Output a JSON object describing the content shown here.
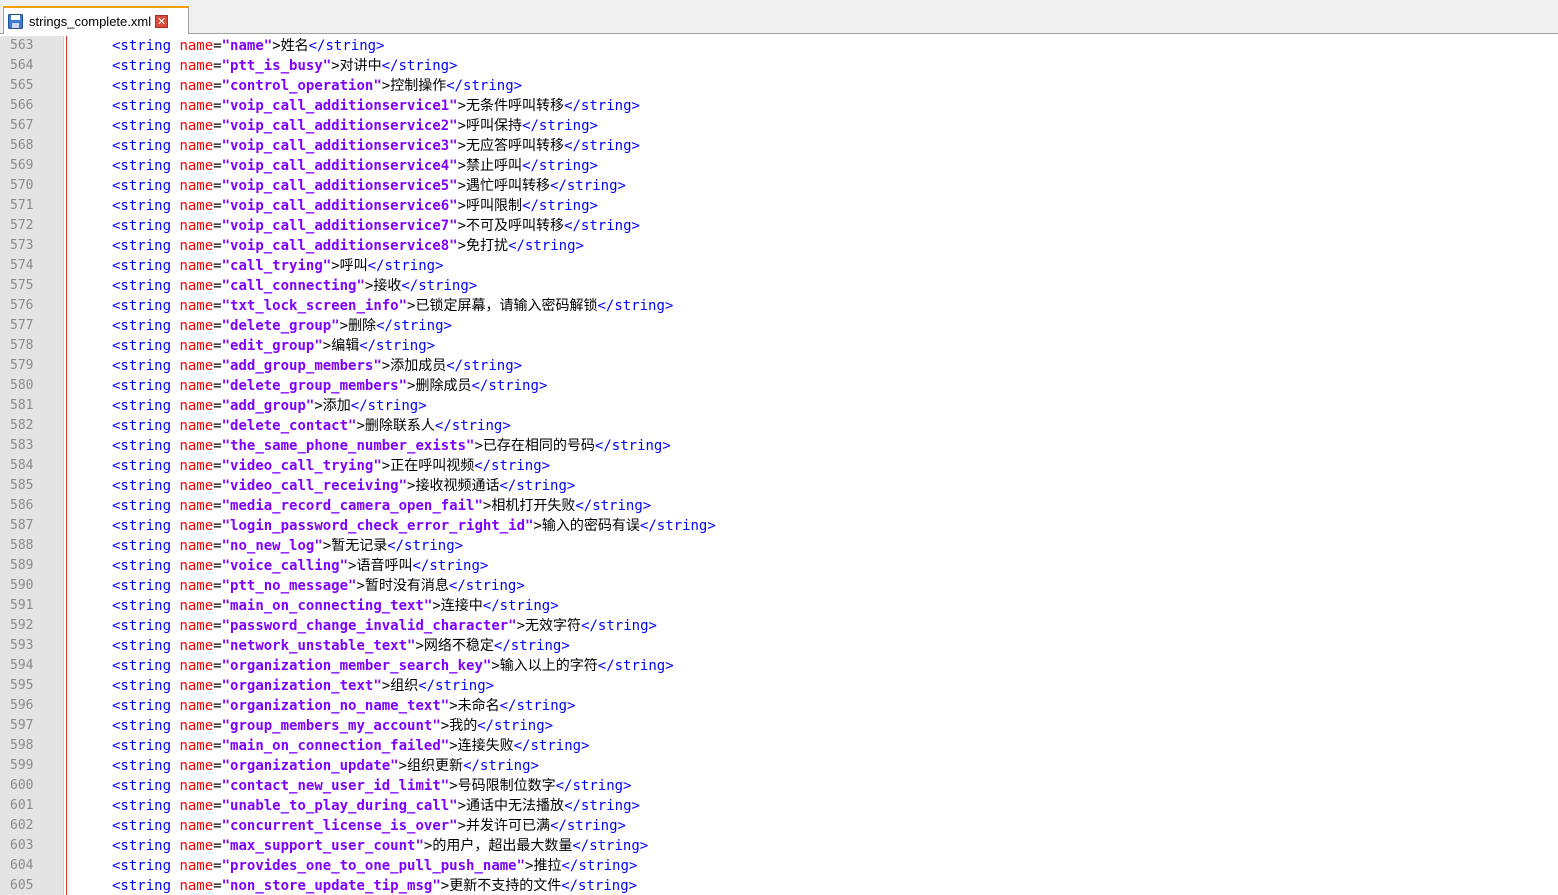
{
  "tab": {
    "file_name": "strings_complete.xml",
    "close_symbol": "✕"
  },
  "code": {
    "open_tag": "<string",
    "attr_name": " name",
    "equals": "=",
    "close_tag": "</string>"
  },
  "lines": [
    {
      "num": "563",
      "name": "\"name\"",
      "text": ">姓名"
    },
    {
      "num": "564",
      "name": "\"ptt_is_busy\"",
      "text": ">对讲中"
    },
    {
      "num": "565",
      "name": "\"control_operation\"",
      "text": ">控制操作"
    },
    {
      "num": "566",
      "name": "\"voip_call_additionservice1\"",
      "text": ">无条件呼叫转移"
    },
    {
      "num": "567",
      "name": "\"voip_call_additionservice2\"",
      "text": ">呼叫保持"
    },
    {
      "num": "568",
      "name": "\"voip_call_additionservice3\"",
      "text": ">无应答呼叫转移"
    },
    {
      "num": "569",
      "name": "\"voip_call_additionservice4\"",
      "text": ">禁止呼叫"
    },
    {
      "num": "570",
      "name": "\"voip_call_additionservice5\"",
      "text": ">遇忙呼叫转移"
    },
    {
      "num": "571",
      "name": "\"voip_call_additionservice6\"",
      "text": ">呼叫限制"
    },
    {
      "num": "572",
      "name": "\"voip_call_additionservice7\"",
      "text": ">不可及呼叫转移"
    },
    {
      "num": "573",
      "name": "\"voip_call_additionservice8\"",
      "text": ">免打扰"
    },
    {
      "num": "574",
      "name": "\"call_trying\"",
      "text": ">呼叫"
    },
    {
      "num": "575",
      "name": "\"call_connecting\"",
      "text": ">接收"
    },
    {
      "num": "576",
      "name": "\"txt_lock_screen_info\"",
      "text": ">已锁定屏幕，请输入密码解锁"
    },
    {
      "num": "577",
      "name": "\"delete_group\"",
      "text": ">删除"
    },
    {
      "num": "578",
      "name": "\"edit_group\"",
      "text": ">编辑"
    },
    {
      "num": "579",
      "name": "\"add_group_members\"",
      "text": ">添加成员"
    },
    {
      "num": "580",
      "name": "\"delete_group_members\"",
      "text": ">删除成员"
    },
    {
      "num": "581",
      "name": "\"add_group\"",
      "text": ">添加"
    },
    {
      "num": "582",
      "name": "\"delete_contact\"",
      "text": ">删除联系人"
    },
    {
      "num": "583",
      "name": "\"the_same_phone_number_exists\"",
      "text": ">已存在相同的号码"
    },
    {
      "num": "584",
      "name": "\"video_call_trying\"",
      "text": ">正在呼叫视频"
    },
    {
      "num": "585",
      "name": "\"video_call_receiving\"",
      "text": ">接收视频通话"
    },
    {
      "num": "586",
      "name": "\"media_record_camera_open_fail\"",
      "text": ">相机打开失败"
    },
    {
      "num": "587",
      "name": "\"login_password_check_error_right_id\"",
      "text": ">输入的密码有误"
    },
    {
      "num": "588",
      "name": "\"no_new_log\"",
      "text": ">暂无记录"
    },
    {
      "num": "589",
      "name": "\"voice_calling\"",
      "text": ">语音呼叫"
    },
    {
      "num": "590",
      "name": "\"ptt_no_message\"",
      "text": ">暂时没有消息"
    },
    {
      "num": "591",
      "name": "\"main_on_connecting_text\"",
      "text": ">连接中"
    },
    {
      "num": "592",
      "name": "\"password_change_invalid_character\"",
      "text": ">无效字符"
    },
    {
      "num": "593",
      "name": "\"network_unstable_text\"",
      "text": ">网络不稳定"
    },
    {
      "num": "594",
      "name": "\"organization_member_search_key\"",
      "text": ">输入以上的字符"
    },
    {
      "num": "595",
      "name": "\"organization_text\"",
      "text": ">组织"
    },
    {
      "num": "596",
      "name": "\"organization_no_name_text\"",
      "text": ">未命名"
    },
    {
      "num": "597",
      "name": "\"group_members_my_account\"",
      "text": ">我的"
    },
    {
      "num": "598",
      "name": "\"main_on_connection_failed\"",
      "text": ">连接失败"
    },
    {
      "num": "599",
      "name": "\"organization_update\"",
      "text": ">组织更新"
    },
    {
      "num": "600",
      "name": "\"contact_new_user_id_limit\"",
      "text": ">号码限制位数字"
    },
    {
      "num": "601",
      "name": "\"unable_to_play_during_call\"",
      "text": ">通话中无法播放"
    },
    {
      "num": "602",
      "name": "\"concurrent_license_is_over\"",
      "text": ">并发许可已满"
    },
    {
      "num": "603",
      "name": "\"max_support_user_count\"",
      "text": ">的用户，超出最大数量"
    },
    {
      "num": "604",
      "name": "\"provides_one_to_one_pull_push_name\"",
      "text": ">推拉"
    },
    {
      "num": "605",
      "name": "\"non_store_update_tip_msg\"",
      "text": ">更新不支持的文件"
    }
  ]
}
